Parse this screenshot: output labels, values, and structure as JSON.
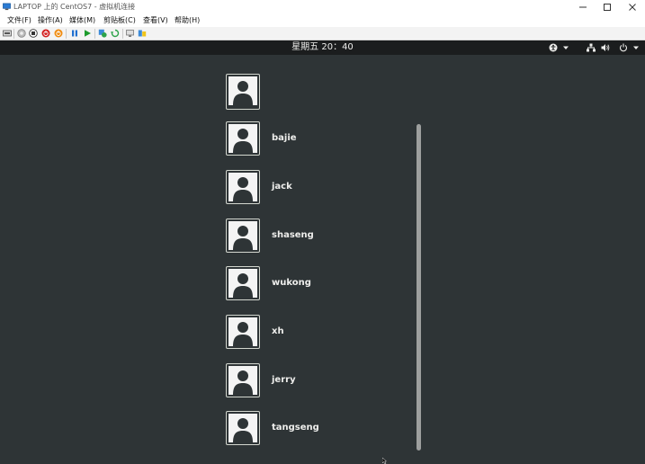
{
  "window": {
    "title": "LAPTOP 上的 CentOS7 - 虚拟机连接",
    "controls": [
      "minimize-icon",
      "maximize-icon",
      "close-icon"
    ]
  },
  "menu": [
    {
      "label": "文件(F)"
    },
    {
      "label": "操作(A)"
    },
    {
      "label": "媒体(M)"
    },
    {
      "label": "剪贴板(C)"
    },
    {
      "label": "查看(V)"
    },
    {
      "label": "帮助(H)"
    }
  ],
  "toolbar": {
    "icons": [
      "ctrl-alt-del-icon",
      "start-icon",
      "turn-off-icon",
      "shutdown-icon",
      "save-icon",
      "pause-icon",
      "resume-icon",
      "checkpoint-icon",
      "revert-icon",
      "enhanced-session-icon",
      "share-icon"
    ]
  },
  "gnome": {
    "clock": "星期五 20：40",
    "tray_icons": [
      "accessibility-icon",
      "network-icon",
      "volume-icon",
      "power-icon"
    ]
  },
  "users": [
    {
      "name": ""
    },
    {
      "name": "bajie"
    },
    {
      "name": "jack"
    },
    {
      "name": "shaseng"
    },
    {
      "name": "wukong"
    },
    {
      "name": "xh"
    },
    {
      "name": "jerry"
    },
    {
      "name": "tangseng"
    }
  ],
  "colors": {
    "desktop_bg": "#2e3436",
    "topbar_bg": "#1b1d1e",
    "text": "#eeeeec"
  }
}
